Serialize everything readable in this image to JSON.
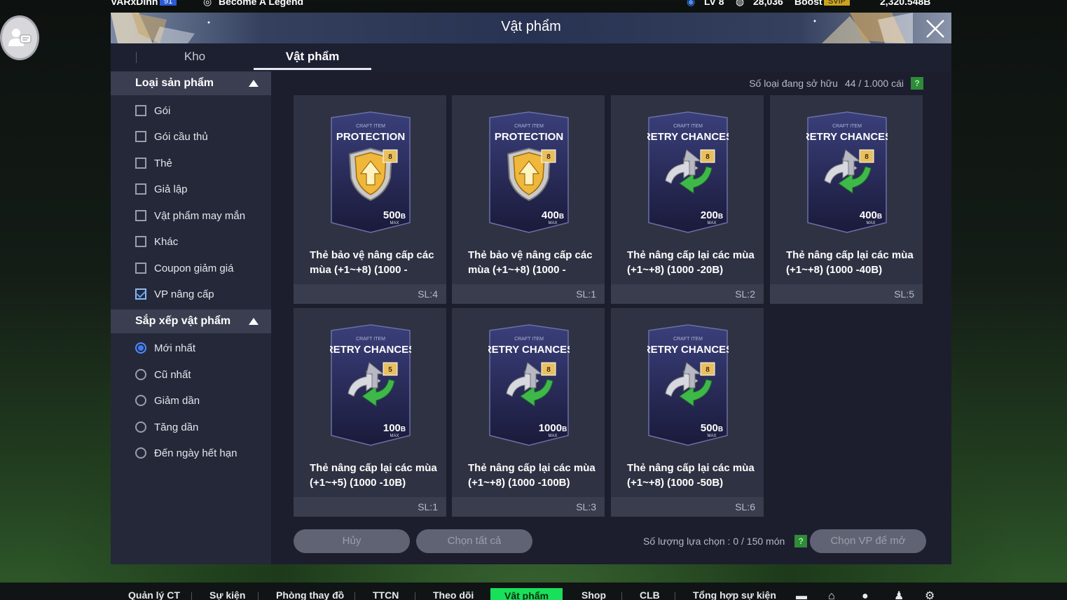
{
  "topbar": {
    "player_name": "VARxDinh",
    "player_rating": "91",
    "motto": "Become A Legend",
    "level": "LV 8",
    "points": "28,036",
    "boost_label": "Boost",
    "vip_label": "SVIP",
    "bp": "2,320.548B"
  },
  "modal": {
    "title": "Vật phẩm",
    "tabs": [
      "Kho",
      "Vật phẩm"
    ],
    "active_tab": "Vật phẩm"
  },
  "sidebar": {
    "category_header": "Loại sản phẩm",
    "categories": [
      {
        "label": "Gói",
        "checked": false
      },
      {
        "label": "Gói cầu thủ",
        "checked": false
      },
      {
        "label": "Thẻ",
        "checked": false
      },
      {
        "label": "Giả lập",
        "checked": false
      },
      {
        "label": "Vật phẩm may mắn",
        "checked": false
      },
      {
        "label": "Khác",
        "checked": false
      },
      {
        "label": "Coupon giảm giá",
        "checked": false
      },
      {
        "label": "VP nâng cấp",
        "checked": true
      }
    ],
    "sort_header": "Sắp xếp vật phẩm",
    "sorts": [
      {
        "label": "Mới nhất",
        "selected": true
      },
      {
        "label": "Cũ nhất",
        "selected": false
      },
      {
        "label": "Giảm dần",
        "selected": false
      },
      {
        "label": "Tăng dần",
        "selected": false
      },
      {
        "label": "Đến ngày hết hạn",
        "selected": false
      }
    ]
  },
  "owned": {
    "label": "Số loại đang sở hữu",
    "value": "44 / 1.000 cái",
    "help": "?"
  },
  "items": [
    {
      "kind": "protection",
      "small": "CRAFT ITEM",
      "title": "PROTECTION",
      "level": "8",
      "value": "500",
      "unit": "B",
      "max": "MAX",
      "name": "Thẻ bảo vệ nâng cấp các mùa (+1~+8) (1000 -",
      "qty": "SL:4"
    },
    {
      "kind": "protection",
      "small": "CRAFT ITEM",
      "title": "PROTECTION",
      "level": "8",
      "value": "400",
      "unit": "B",
      "max": "MAX",
      "name": "Thẻ bảo vệ nâng cấp các mùa (+1~+8) (1000 -",
      "qty": "SL:1"
    },
    {
      "kind": "retry",
      "small": "CRAFT ITEM",
      "title": "RETRY CHANCES",
      "level": "8",
      "value": "200",
      "unit": "B",
      "max": "MAX",
      "name": "Thẻ nâng cấp lại các mùa (+1~+8) (1000 -20B)",
      "qty": "SL:2"
    },
    {
      "kind": "retry",
      "small": "CRAFT ITEM",
      "title": "RETRY CHANCES",
      "level": "8",
      "value": "400",
      "unit": "B",
      "max": "MAX",
      "name": "Thẻ nâng cấp lại các mùa (+1~+8) (1000 -40B)",
      "qty": "SL:5"
    },
    {
      "kind": "retry",
      "small": "CRAFT ITEM",
      "title": "RETRY CHANCES",
      "level": "5",
      "value": "100",
      "unit": "B",
      "max": "MAX",
      "name": "Thẻ nâng cấp lại các mùa (+1~+5) (1000 -10B)",
      "qty": "SL:1"
    },
    {
      "kind": "retry",
      "small": "CRAFT ITEM",
      "title": "RETRY CHANCES",
      "level": "8",
      "value": "1000",
      "unit": "B",
      "max": "MAX",
      "name": "Thẻ nâng cấp lại các mùa (+1~+8) (1000 -100B)",
      "qty": "SL:3"
    },
    {
      "kind": "retry",
      "small": "CRAFT ITEM",
      "title": "RETRY CHANCES",
      "level": "8",
      "value": "500",
      "unit": "B",
      "max": "MAX",
      "name": "Thẻ nâng cấp lại các mùa (+1~+8) (1000 -50B)",
      "qty": "SL:6"
    }
  ],
  "footer": {
    "cancel": "Hủy",
    "select_all": "Chọn tất cả",
    "selected_label": "Số lượng lựa chọn : 0 / 150 món",
    "help": "?",
    "open": "Chọn VP để mở"
  },
  "bottom_nav": {
    "items": [
      "Quản lý CT",
      "Sự kiện",
      "Phòng thay đồ",
      "TTCN",
      "Theo dõi",
      "Vật phẩm",
      "Shop",
      "CLB",
      "Tổng hợp sự kiện"
    ],
    "active": "Vật phẩm",
    "icons": [
      "chat-icon",
      "home-icon",
      "coach-icon",
      "friend-icon",
      "settings-icon"
    ]
  },
  "colors": {
    "accent_green": "#19e05a",
    "checkbox_blue": "#4fa3ff",
    "modal_bg": "#1c1e2d"
  }
}
